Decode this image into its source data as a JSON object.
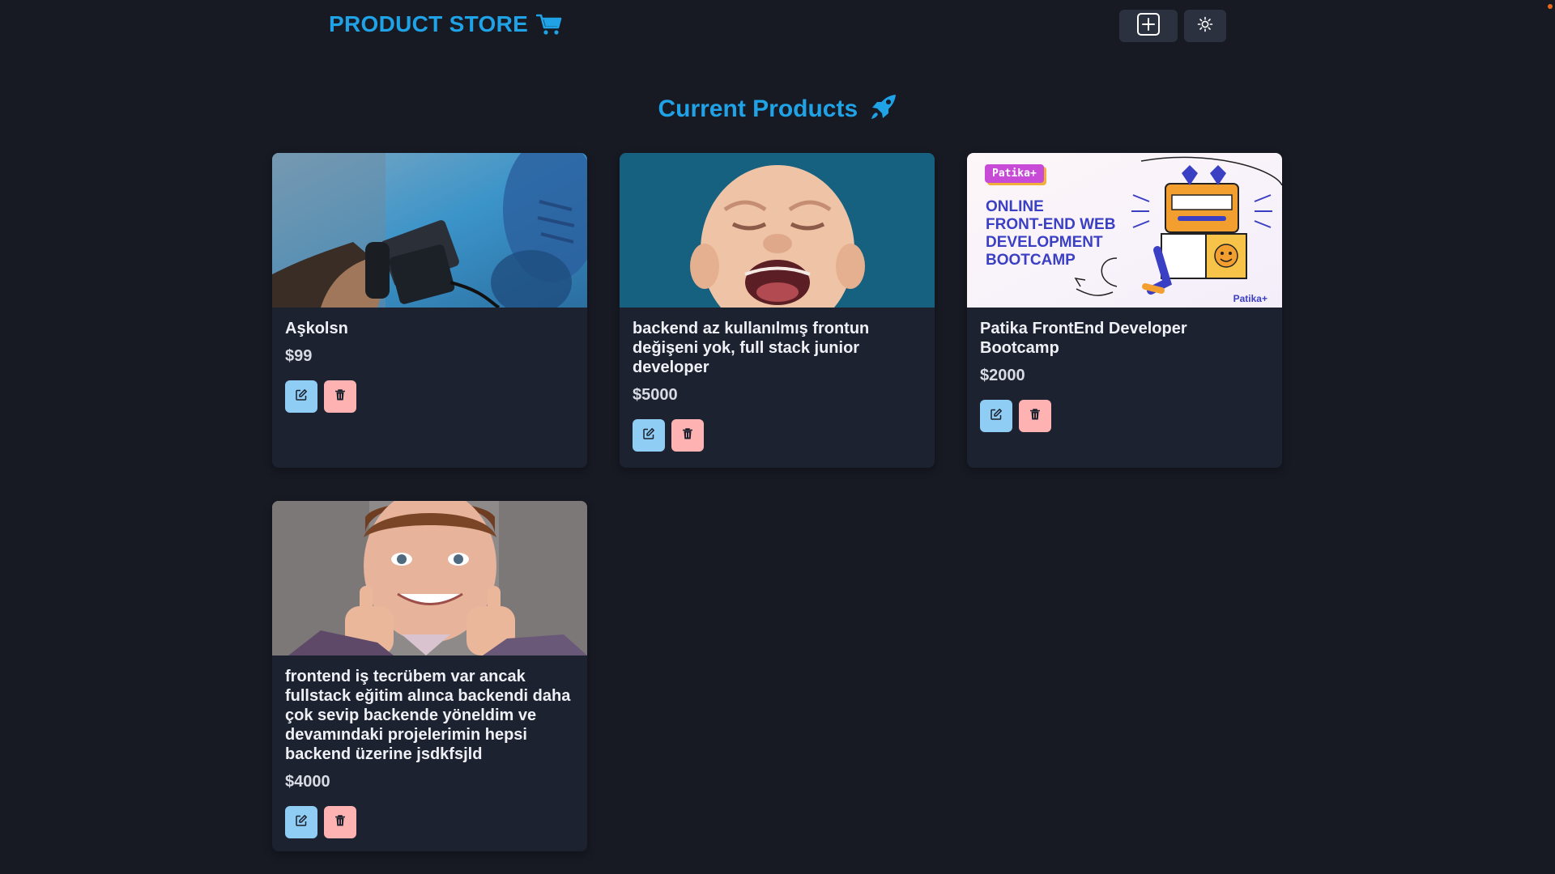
{
  "navbar": {
    "brand": "PRODUCT STORE",
    "brand_icon": "shopping-cart-icon",
    "create_button_icon": "plus-square-icon",
    "theme_button_icon": "sun-icon"
  },
  "main": {
    "heading": "Current Products",
    "heading_icon": "rocket-icon"
  },
  "products": [
    {
      "name": "Aşkolsn",
      "price": "$99",
      "image": "hand holding phone with gimbal"
    },
    {
      "name": "backend az kullanılmış frontun değişeni yok, full stack junior developer",
      "price": "$5000",
      "image": "crying baby"
    },
    {
      "name": "Patika FrontEnd Developer Bootcamp",
      "price": "$2000",
      "image": "patika bootcamp banner",
      "banner": {
        "badge": "Patika+",
        "lines": [
          "ONLINE",
          "FRONT-END WEB",
          "DEVELOPMENT",
          "BOOTCAMP"
        ],
        "logo": "Patika+"
      }
    },
    {
      "name": "frontend iş tecrübem var ancak fullstack eğitim alınca backendi daha çok sevip backende yöneldim ve devamındaki projelerimin hepsi backend üzerine jsdkfsjld",
      "price": "$4000",
      "image": "smiling boy thumbs up"
    }
  ],
  "actions": {
    "edit_icon": "edit-icon",
    "delete_icon": "trash-icon"
  },
  "colors": {
    "background": "#171923",
    "card": "#1d2230",
    "accent": "#1fa2e6",
    "edit_button": "#90cdf4",
    "delete_button": "#feb2b2"
  }
}
